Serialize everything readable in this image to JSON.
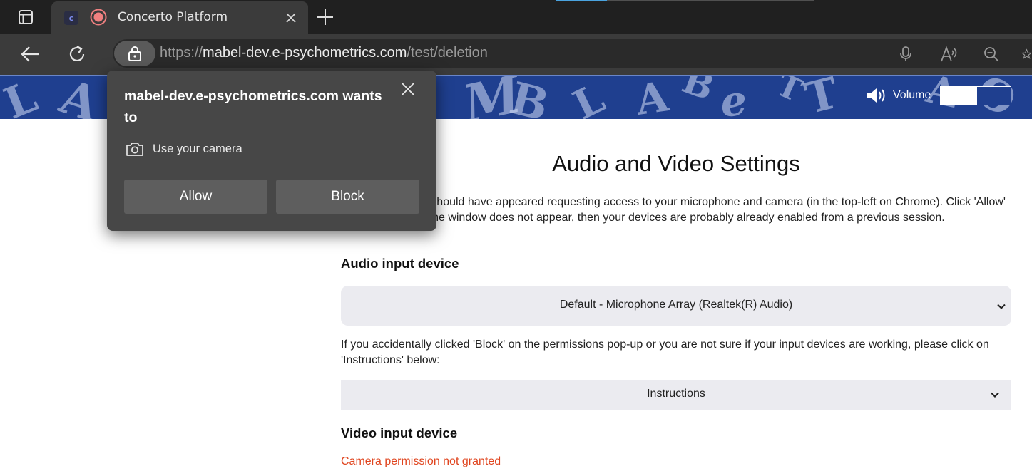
{
  "browser": {
    "tab": {
      "title": "Concerto Platform",
      "favicon_letter": "c"
    },
    "url": {
      "scheme": "https://",
      "host": "mabel-dev.e-psychometrics.com",
      "path": "/test/deletion"
    }
  },
  "banner": {
    "letters": [
      "L",
      "A",
      "M",
      "B",
      "L",
      "A",
      "B",
      "e",
      "T",
      "T",
      "A",
      "O"
    ],
    "volume_label": "Volume",
    "volume_level_percent": 52
  },
  "page": {
    "title": "Audio and Video Settings",
    "intro": "A pop-up window should have appeared requesting access to your microphone and camera (in the top-left on Chrome). Click 'Allow' on this pop-up. If the window does not appear, then your devices are probably already enabled from a previous session.",
    "audio": {
      "heading": "Audio input device",
      "selected": "Default - Microphone Array (Realtek(R) Audio)"
    },
    "hint": "If you accidentally clicked 'Block' on the permissions pop-up or you are not sure if your input devices are working, please click on 'Instructions' below:",
    "instructions_label": "Instructions",
    "video": {
      "heading": "Video input device",
      "error": "Camera permission not granted"
    }
  },
  "popup": {
    "heading": "mabel-dev.e-psychometrics.com wants to",
    "permission": "Use your camera",
    "allow_label": "Allow",
    "block_label": "Block"
  },
  "colors": {
    "banner": "#1f3f8f",
    "error": "#e0451f",
    "popup_bg": "#474747"
  }
}
